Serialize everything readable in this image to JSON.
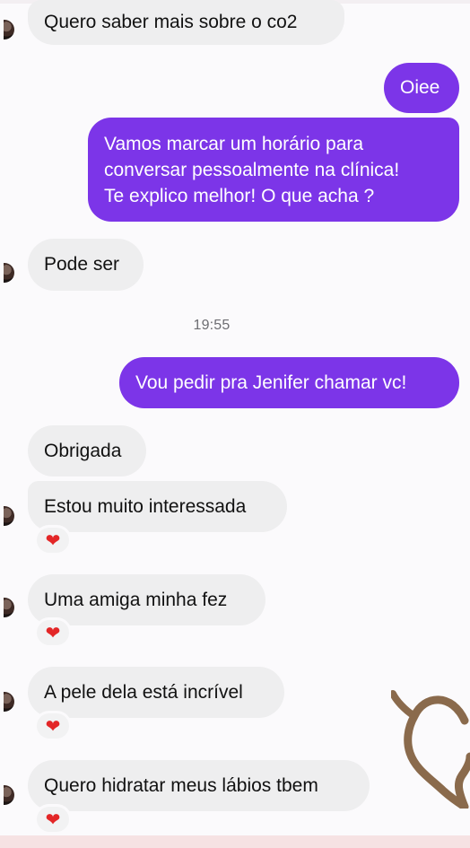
{
  "conversation": {
    "messages": [
      {
        "direction": "incoming",
        "text": "Quero saber mais sobre o co2"
      },
      {
        "direction": "outgoing",
        "text": "Oiee"
      },
      {
        "direction": "outgoing",
        "lines": [
          "Vamos marcar um horário para",
          "conversar pessoalmente na clínica!",
          "Te explico melhor! O que acha ?"
        ]
      },
      {
        "direction": "incoming",
        "text": "Pode ser"
      },
      {
        "direction": "time",
        "text": "19:55"
      },
      {
        "direction": "outgoing",
        "text": "Vou pedir pra Jenifer chamar vc!"
      },
      {
        "direction": "incoming",
        "text": "Obrigada"
      },
      {
        "direction": "incoming",
        "text": "Estou muito interessada"
      },
      {
        "direction": "incoming",
        "text": "Uma amiga minha fez"
      },
      {
        "direction": "incoming",
        "text": "A pele dela está incrível"
      },
      {
        "direction": "incoming",
        "text": "Quero hidratar meus lábios tbem"
      }
    ]
  },
  "reaction": {
    "emoji": "❤"
  },
  "colors": {
    "outgoing_bubble": "#7c35e8",
    "incoming_bubble": "#eeeeef",
    "reaction_heart": "#e32627",
    "sticker_heart": "#8a6a4c"
  },
  "icons": {
    "sender_avatar": "avatar-icon",
    "reaction": "heart-icon",
    "sticker": "heart-sticker-icon"
  }
}
